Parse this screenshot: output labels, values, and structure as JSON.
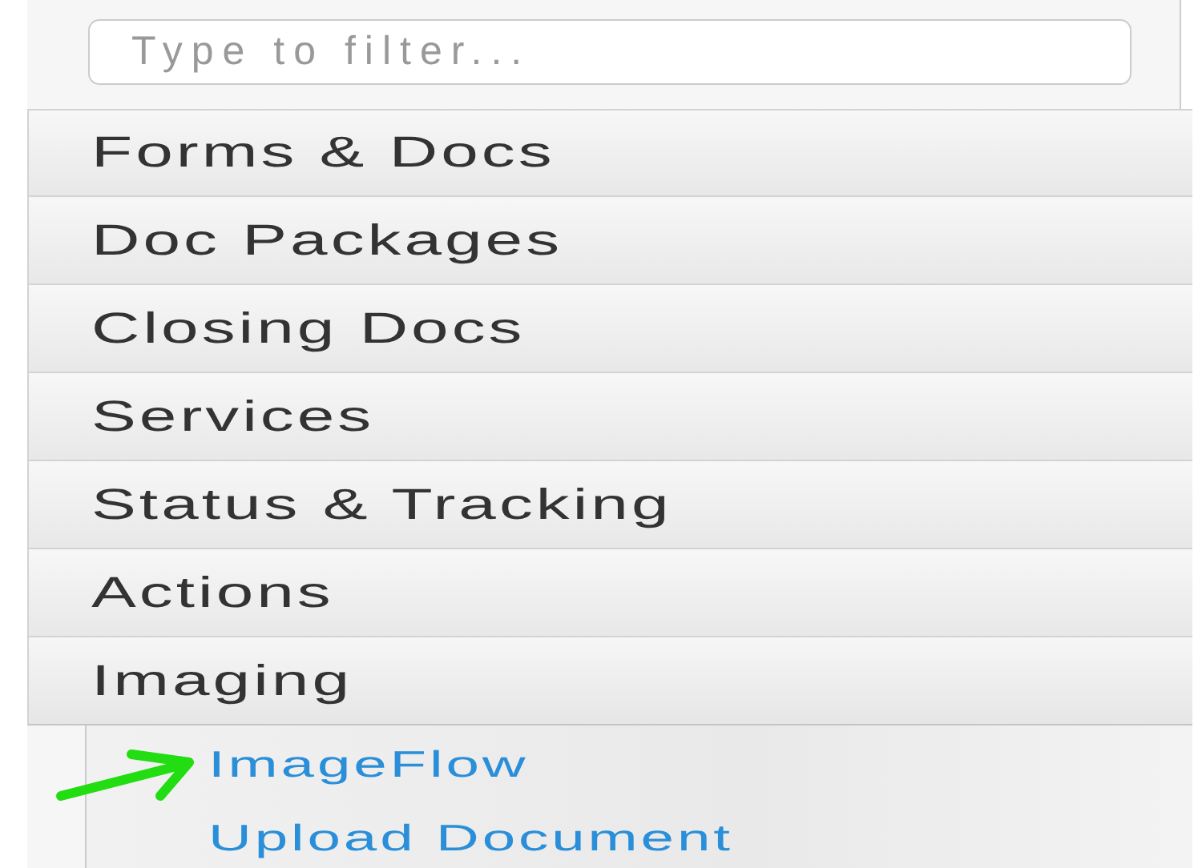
{
  "filter": {
    "placeholder": "Type to filter..."
  },
  "sections": [
    {
      "label": "Forms & Docs",
      "expanded": false
    },
    {
      "label": "Doc Packages",
      "expanded": false
    },
    {
      "label": "Closing Docs",
      "expanded": false
    },
    {
      "label": "Services",
      "expanded": false
    },
    {
      "label": "Status & Tracking",
      "expanded": false
    },
    {
      "label": "Actions",
      "expanded": false
    },
    {
      "label": "Imaging",
      "expanded": true,
      "children": [
        {
          "label": "ImageFlow"
        },
        {
          "label": "Upload Document"
        }
      ]
    }
  ]
}
